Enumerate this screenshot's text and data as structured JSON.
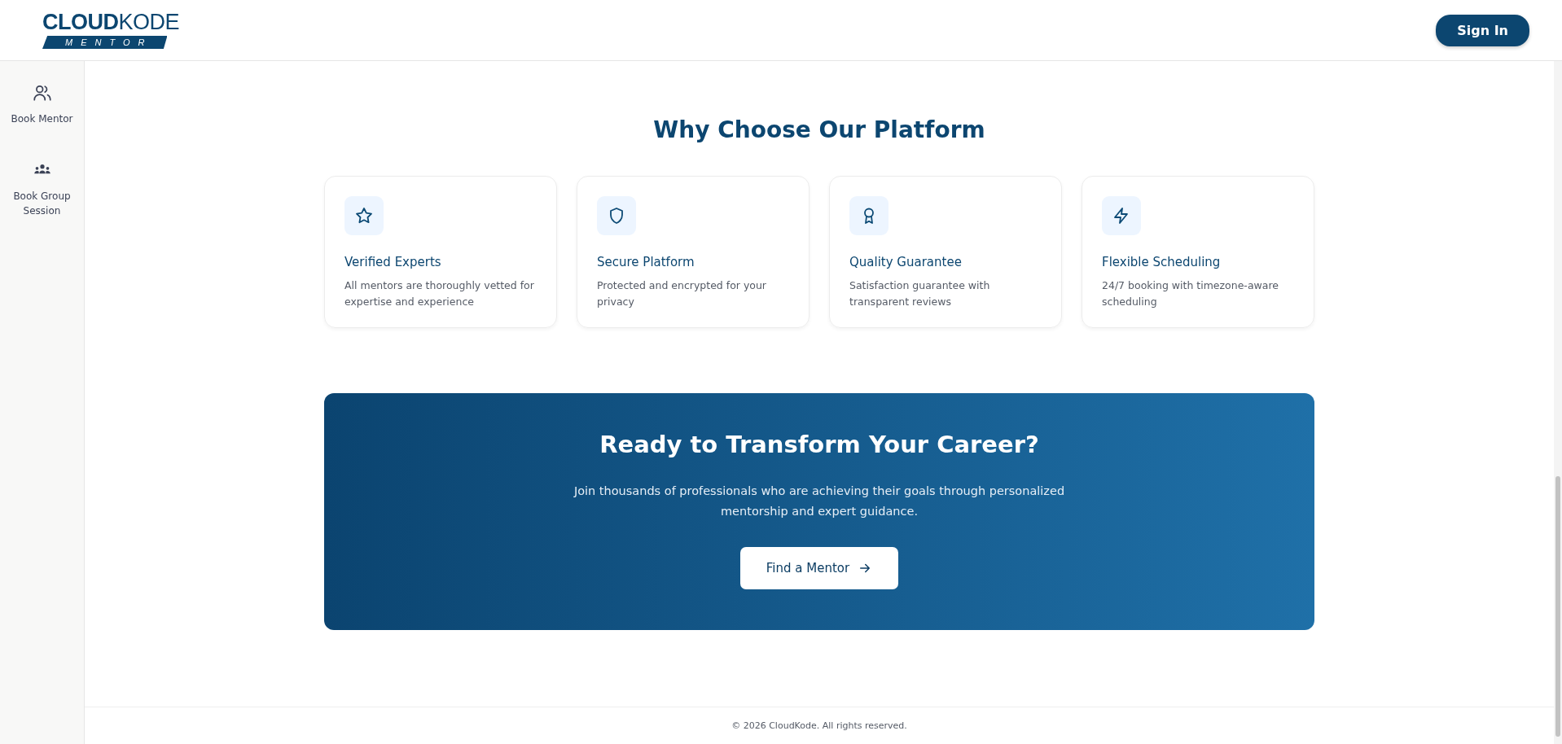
{
  "header": {
    "logo": {
      "primary": "CLOUD",
      "secondary": "KODE",
      "tagline": "MENTOR"
    },
    "sign_in": "Sign In"
  },
  "sidebar": {
    "items": [
      {
        "label": "Book Mentor",
        "kind": "users"
      },
      {
        "label": "Book Group Session",
        "kind": "group"
      }
    ]
  },
  "features": {
    "title": "Why Choose Our Platform",
    "cards": [
      {
        "kind": "star",
        "title": "Verified Experts",
        "text": "All mentors are thoroughly vetted for expertise and experience"
      },
      {
        "kind": "shield",
        "title": "Secure Platform",
        "text": "Protected and encrypted for your privacy"
      },
      {
        "kind": "award",
        "title": "Quality Guarantee",
        "text": "Satisfaction guarantee with transparent reviews"
      },
      {
        "kind": "zap",
        "title": "Flexible Scheduling",
        "text": "24/7 booking with timezone-aware scheduling"
      }
    ]
  },
  "cta": {
    "title": "Ready to Transform Your Career?",
    "text": "Join thousands of professionals who are achieving their goals through personalized mentorship and expert guidance.",
    "button": "Find a Mentor"
  },
  "footer": {
    "text": "© 2026 CloudKode. All rights reserved."
  }
}
